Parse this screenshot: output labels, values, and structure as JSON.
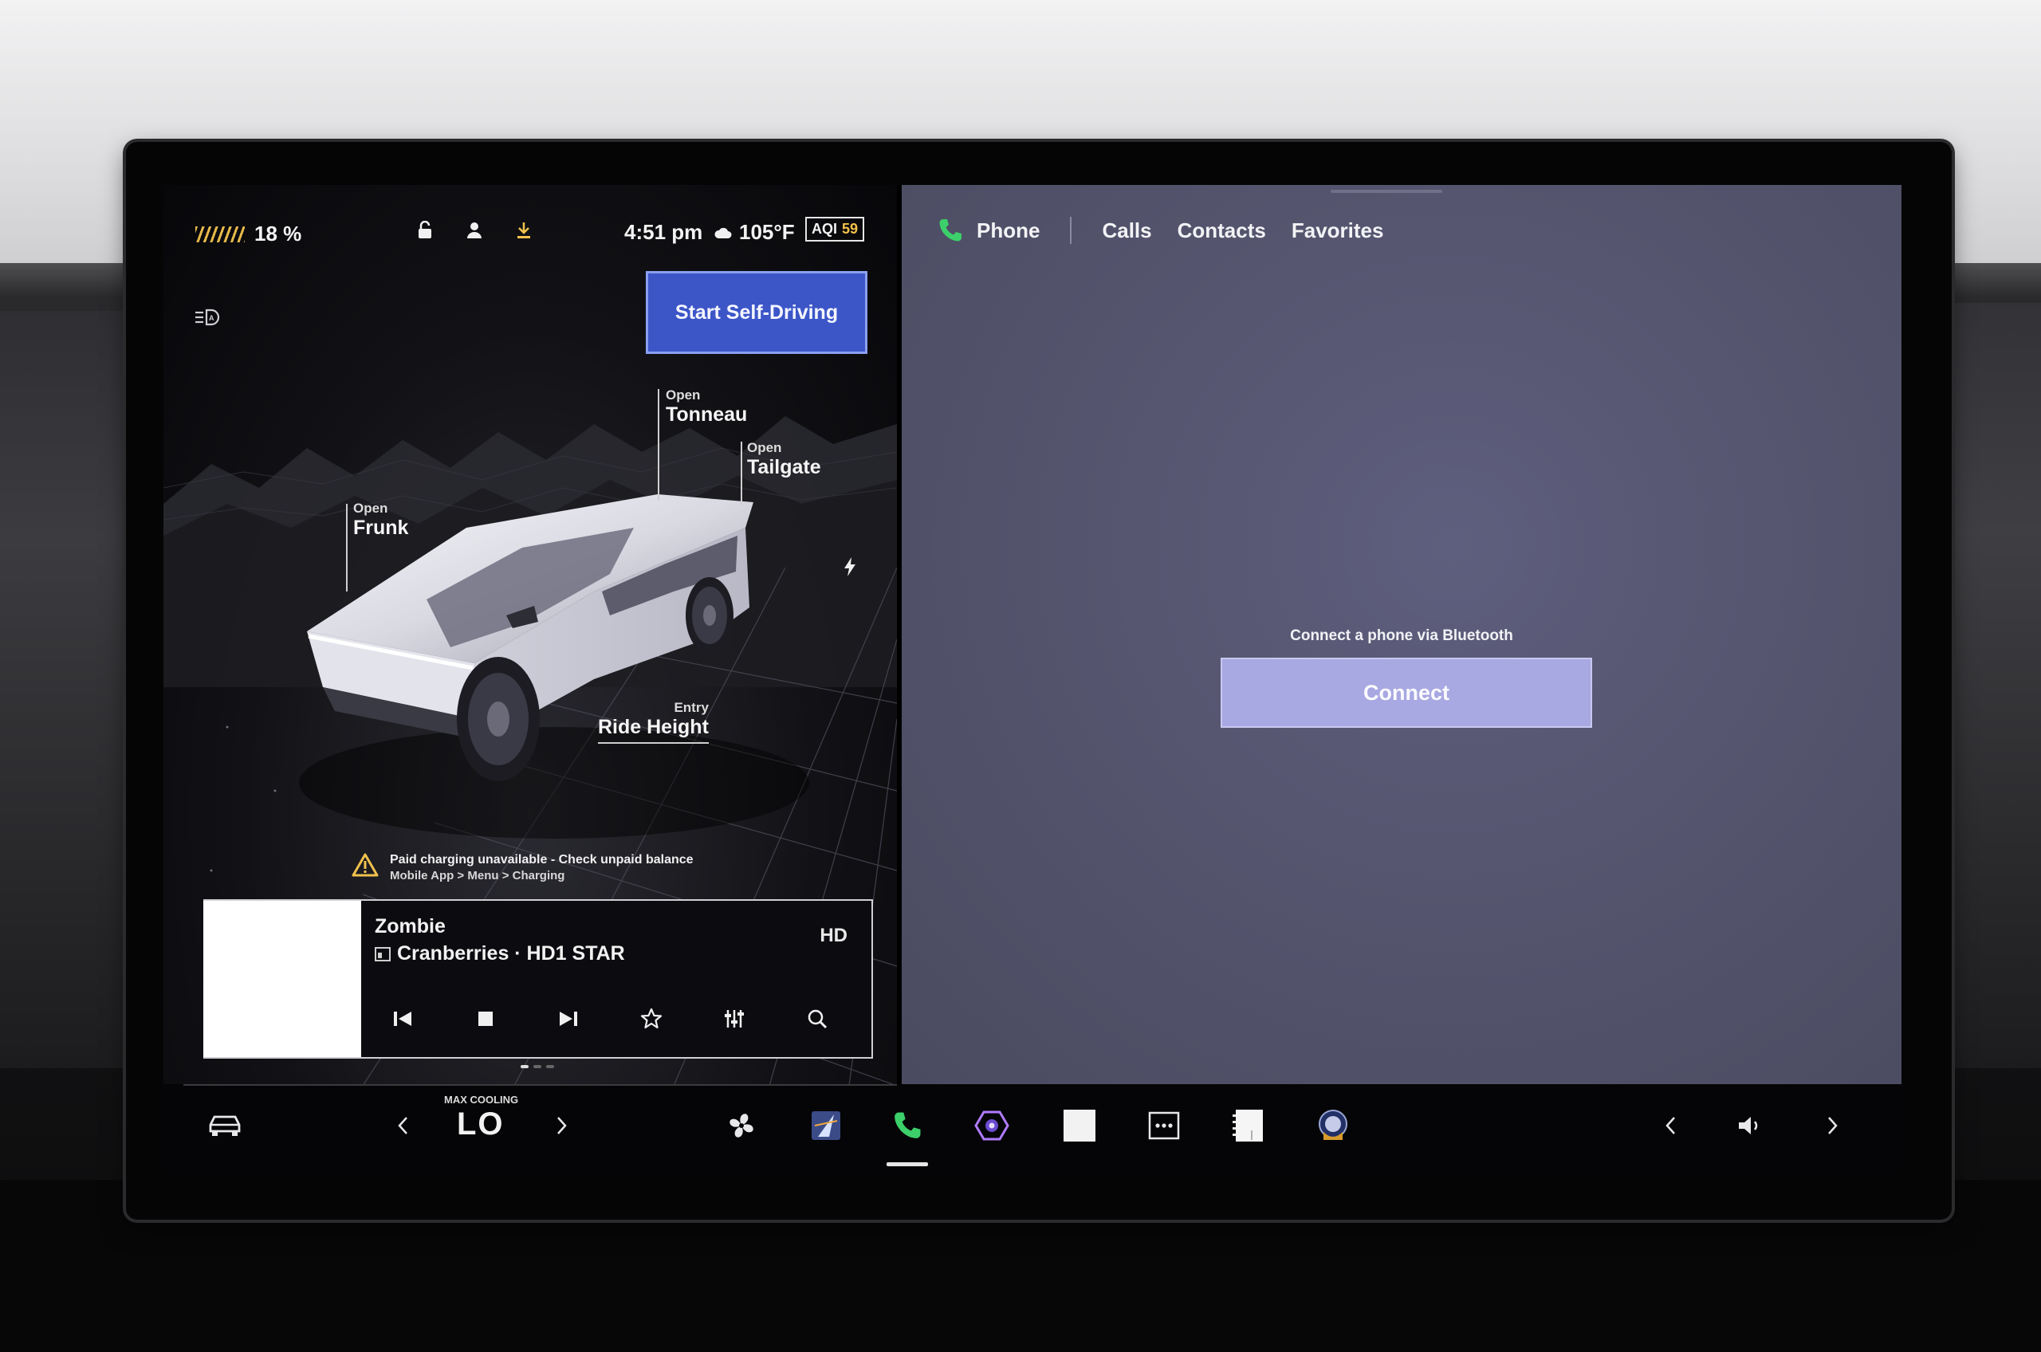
{
  "status": {
    "battery_percent": "18 %",
    "time": "4:51 pm",
    "temperature": "105°F",
    "aqi_label": "AQI",
    "aqi_value": "59",
    "icons": [
      "lock-icon",
      "profile-icon",
      "download-icon"
    ]
  },
  "car": {
    "self_driving_label": "Start Self-Driving",
    "callouts": {
      "frunk": {
        "action": "Open",
        "label": "Frunk"
      },
      "tonneau": {
        "action": "Open",
        "label": "Tonneau"
      },
      "tailgate": {
        "action": "Open",
        "label": "Tailgate"
      },
      "ride_height": {
        "action": "Entry",
        "label": "Ride Height"
      }
    },
    "alert": {
      "line1": "Paid charging unavailable - Check unpaid balance",
      "line2": "Mobile App > Menu > Charging"
    }
  },
  "media": {
    "song": "Zombie",
    "artist_station": "Cranberries · HD1 STAR",
    "source_badge": "HD",
    "controls": [
      "previous-icon",
      "stop-icon",
      "next-icon",
      "favorite-icon",
      "equalizer-icon",
      "search-icon"
    ],
    "page_count": 3,
    "active_page": 1
  },
  "phone": {
    "title": "Phone",
    "tabs": [
      "Calls",
      "Contacts",
      "Favorites"
    ],
    "bt_hint": "Connect a phone via Bluetooth",
    "connect_label": "Connect"
  },
  "dock": {
    "climate_mode": "MAX COOLING",
    "climate_temp": "LO",
    "apps": [
      "fan-icon",
      "navigation-icon",
      "phone-icon",
      "camera-icon",
      "blank-app-icon",
      "more-icon",
      "notes-icon",
      "game-icon"
    ],
    "active_app": "phone-icon"
  },
  "colors": {
    "accent_blue": "#3c56c8",
    "connect_button": "#a8a8e2",
    "phone_green": "#3ccf6a",
    "warning_yellow": "#f1c24d"
  }
}
